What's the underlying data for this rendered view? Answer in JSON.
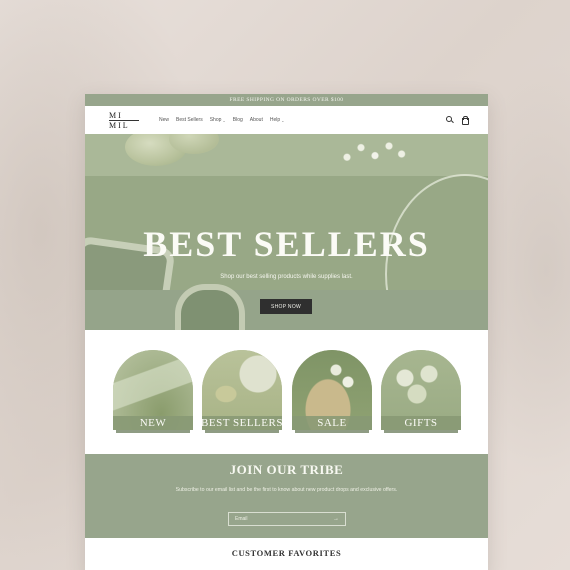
{
  "announcement": "FREE SHIPPING ON ORDERS OVER $100",
  "logo": {
    "top": "MI",
    "bottom": "MIL"
  },
  "nav": {
    "items": [
      {
        "label": "New",
        "has_dropdown": false
      },
      {
        "label": "Best Sellers",
        "has_dropdown": false
      },
      {
        "label": "Shop",
        "has_dropdown": true
      },
      {
        "label": "Blog",
        "has_dropdown": false
      },
      {
        "label": "About",
        "has_dropdown": false
      },
      {
        "label": "Help",
        "has_dropdown": true
      }
    ],
    "chevron": "⌄"
  },
  "header_icons": [
    "search-icon",
    "cart-icon"
  ],
  "hero": {
    "title": "BEST SELLERS",
    "subtitle": "Shop our best selling products while supplies last.",
    "button_label": "SHOP NOW"
  },
  "collections": [
    {
      "label": "NEW"
    },
    {
      "label": "BEST SELLERS"
    },
    {
      "label": "SALE"
    },
    {
      "label": "GIFTS"
    }
  ],
  "newsletter": {
    "title": "JOIN OUR TRIBE",
    "text": "Subscribe to our email list and be the first to know about new product drops and exclusive offers.",
    "email_placeholder": "Email",
    "arrow": "→"
  },
  "favorites_title": "CUSTOMER FAVORITES",
  "colors": {
    "sage": "#97a58c",
    "button_dark": "#2f2f2f",
    "background": "#e6ddd7"
  }
}
